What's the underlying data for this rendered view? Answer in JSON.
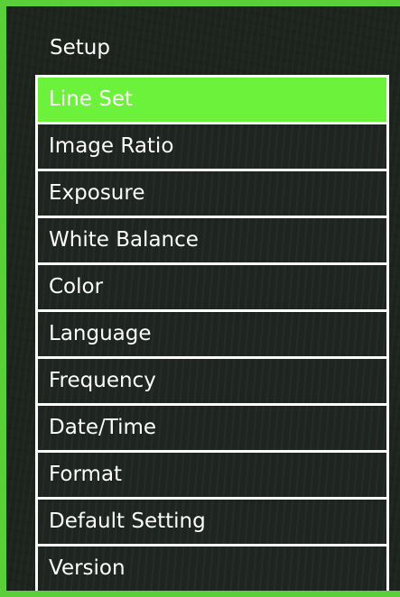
{
  "menu": {
    "title": "Setup",
    "selected_index": 0,
    "items": [
      {
        "label": "Line Set"
      },
      {
        "label": "Image Ratio"
      },
      {
        "label": "Exposure"
      },
      {
        "label": "White Balance"
      },
      {
        "label": "Color"
      },
      {
        "label": "Language"
      },
      {
        "label": "Frequency"
      },
      {
        "label": "Date/Time"
      },
      {
        "label": "Format"
      },
      {
        "label": "Default Setting"
      },
      {
        "label": "Version"
      }
    ]
  },
  "colors": {
    "frame": "#5bcf3b",
    "background": "#1d231d",
    "selected": "#6cf23a",
    "divider": "#ffffff",
    "text": "#ffffff"
  }
}
